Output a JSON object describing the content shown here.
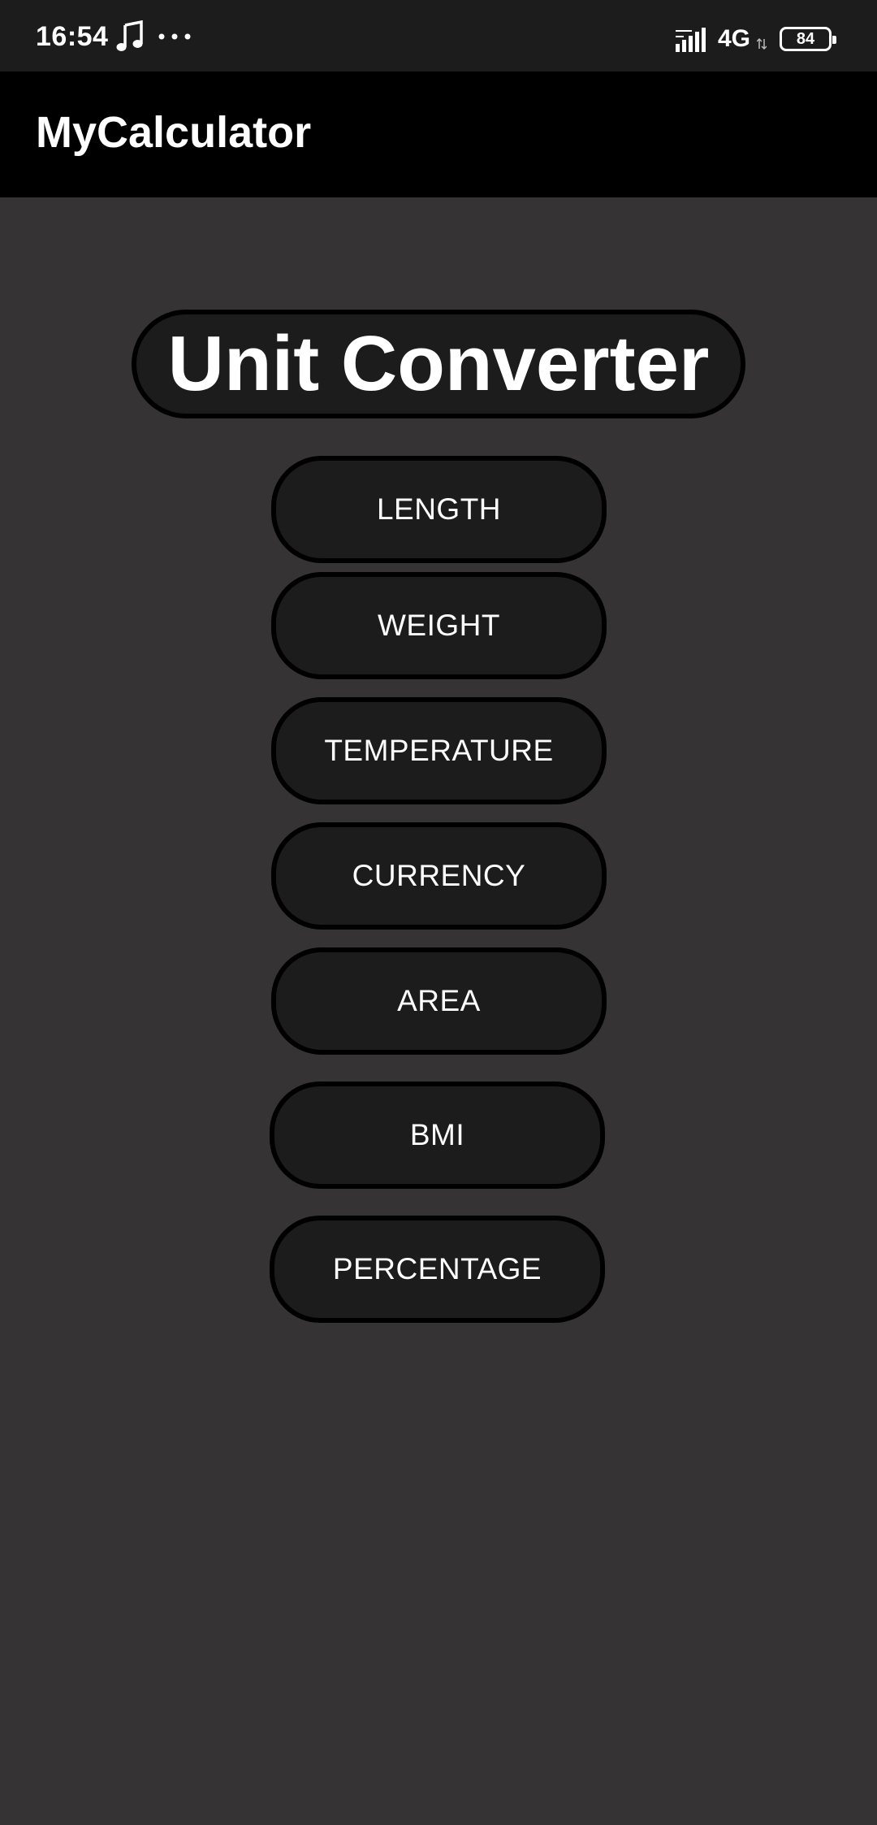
{
  "status_bar": {
    "time": "16:54",
    "network": "4G",
    "battery": "84",
    "icons": [
      "music-note-icon",
      "more-dots-icon",
      "signal-bars-icon",
      "data-arrows-icon",
      "battery-icon"
    ]
  },
  "app_bar": {
    "title": "MyCalculator"
  },
  "main": {
    "heading": "Unit Converter",
    "buttons": [
      {
        "label": "LENGTH"
      },
      {
        "label": "WEIGHT"
      },
      {
        "label": "TEMPERATURE"
      },
      {
        "label": "CURRENCY"
      },
      {
        "label": "AREA"
      },
      {
        "label": "BMI"
      },
      {
        "label": "PERCENTAGE"
      }
    ]
  },
  "colors": {
    "background": "#353334",
    "app_bar": "#000000",
    "status_bar": "#1c1c1c",
    "button_fill": "#1c1c1c",
    "button_border": "#000000",
    "text": "#ffffff"
  }
}
